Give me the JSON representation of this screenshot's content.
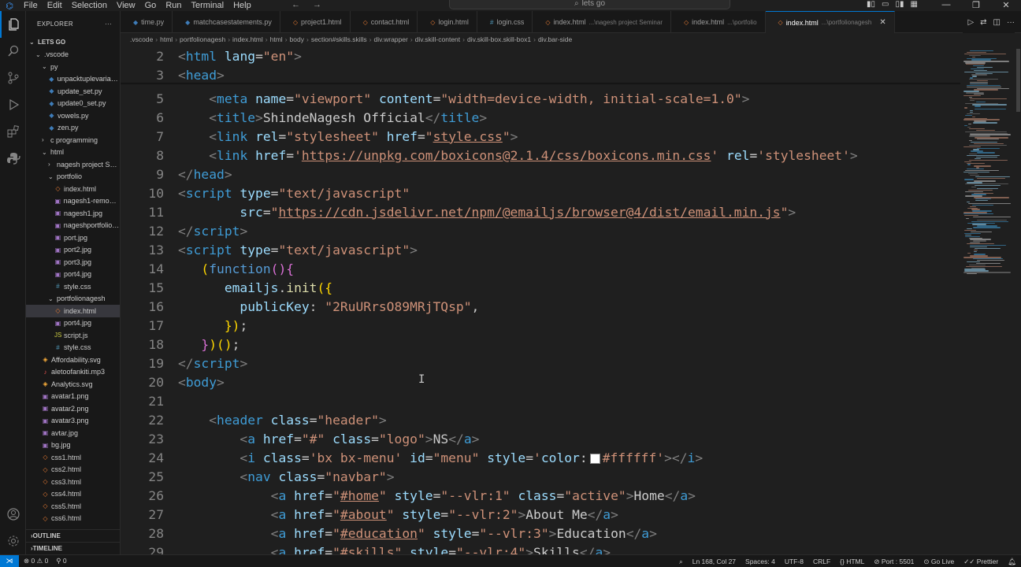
{
  "titlebar": {
    "menu": [
      "File",
      "Edit",
      "Selection",
      "View",
      "Go",
      "Run",
      "Terminal",
      "Help"
    ],
    "search_text": "lets go"
  },
  "explorer": {
    "title": "EXPLORER",
    "more": "···",
    "root": "LETS GO",
    "outline": "OUTLINE",
    "timeline": "TIMELINE"
  },
  "tree": [
    {
      "depth": 1,
      "kind": "folder-open",
      "name": ".vscode"
    },
    {
      "depth": 2,
      "kind": "folder-open",
      "name": "py"
    },
    {
      "depth": 3,
      "kind": "py",
      "name": "unpacktuplevariabl..."
    },
    {
      "depth": 3,
      "kind": "py",
      "name": "update_set.py"
    },
    {
      "depth": 3,
      "kind": "py",
      "name": "update0_set.py"
    },
    {
      "depth": 3,
      "kind": "py",
      "name": "vowels.py"
    },
    {
      "depth": 3,
      "kind": "py",
      "name": "zen.py"
    },
    {
      "depth": 2,
      "kind": "folder",
      "name": "c programming"
    },
    {
      "depth": 2,
      "kind": "folder-open",
      "name": "html"
    },
    {
      "depth": 3,
      "kind": "folder",
      "name": "nagesh project Se..."
    },
    {
      "depth": 3,
      "kind": "folder-open",
      "name": "portfolio"
    },
    {
      "depth": 4,
      "kind": "html",
      "name": "index.html"
    },
    {
      "depth": 4,
      "kind": "img",
      "name": "nagesh1-remove..."
    },
    {
      "depth": 4,
      "kind": "img",
      "name": "nagesh1.jpg"
    },
    {
      "depth": 4,
      "kind": "img",
      "name": "nageshportfolio.j..."
    },
    {
      "depth": 4,
      "kind": "img",
      "name": "port.jpg"
    },
    {
      "depth": 4,
      "kind": "img",
      "name": "port2.jpg"
    },
    {
      "depth": 4,
      "kind": "img",
      "name": "port3.jpg"
    },
    {
      "depth": 4,
      "kind": "img",
      "name": "port4.jpg"
    },
    {
      "depth": 4,
      "kind": "css",
      "name": "style.css"
    },
    {
      "depth": 3,
      "kind": "folder-open",
      "name": "portfolionagesh"
    },
    {
      "depth": 4,
      "kind": "html",
      "name": "index.html",
      "selected": true
    },
    {
      "depth": 4,
      "kind": "img",
      "name": "port4.jpg"
    },
    {
      "depth": 4,
      "kind": "js",
      "name": "script.js"
    },
    {
      "depth": 4,
      "kind": "css",
      "name": "style.css"
    },
    {
      "depth": 2,
      "kind": "svg",
      "name": "Affordability.svg"
    },
    {
      "depth": 2,
      "kind": "mp3",
      "name": "aletoofankiti.mp3"
    },
    {
      "depth": 2,
      "kind": "svg",
      "name": "Analytics.svg"
    },
    {
      "depth": 2,
      "kind": "img",
      "name": "avatar1.png"
    },
    {
      "depth": 2,
      "kind": "img",
      "name": "avatar2.png"
    },
    {
      "depth": 2,
      "kind": "img",
      "name": "avatar3.png"
    },
    {
      "depth": 2,
      "kind": "img",
      "name": "avtar.jpg"
    },
    {
      "depth": 2,
      "kind": "img",
      "name": "bg.jpg"
    },
    {
      "depth": 2,
      "kind": "html",
      "name": "css1.html"
    },
    {
      "depth": 2,
      "kind": "html",
      "name": "css2.html"
    },
    {
      "depth": 2,
      "kind": "html",
      "name": "css3.html"
    },
    {
      "depth": 2,
      "kind": "html",
      "name": "css4.html"
    },
    {
      "depth": 2,
      "kind": "html",
      "name": "css5.html"
    },
    {
      "depth": 2,
      "kind": "html",
      "name": "css6.html"
    }
  ],
  "tabs": [
    {
      "label": "time.py",
      "kind": "py"
    },
    {
      "label": "matchcasestatements.py",
      "kind": "py"
    },
    {
      "label": "project1.html",
      "kind": "html"
    },
    {
      "label": "contact.html",
      "kind": "html"
    },
    {
      "label": "login.html",
      "kind": "html"
    },
    {
      "label": "login.css",
      "kind": "css"
    },
    {
      "label": "index.html",
      "desc": "...\\nagesh project Seminar",
      "kind": "html"
    },
    {
      "label": "index.html",
      "desc": "...\\portfolio",
      "kind": "html"
    },
    {
      "label": "index.html",
      "desc": "...\\portfolionagesh",
      "kind": "html",
      "active": true
    }
  ],
  "breadcrumb": [
    ".vscode",
    "html",
    "portfolionagesh",
    "index.html",
    "html",
    "body",
    "section#skills.skills",
    "div.wrapper",
    "div.skill-content",
    "div.skill-box.skill-box1",
    "div.bar-side"
  ],
  "editor": {
    "line_numbers": [
      "2",
      "3",
      "5",
      "6",
      "7",
      "8",
      "9",
      "10",
      "11",
      "12",
      "13",
      "14",
      "15",
      "16",
      "17",
      "18",
      "19",
      "20",
      "21",
      "22",
      "23",
      "24",
      "25",
      "26",
      "27",
      "28",
      "29"
    ]
  },
  "status": {
    "errors": "0",
    "warnings": "0",
    "ports": "0",
    "position": "Ln 168, Col 27",
    "spaces": "Spaces: 4",
    "encoding": "UTF-8",
    "eol": "CRLF",
    "language": "HTML",
    "port": "Port : 5501",
    "golive": "Go Live",
    "prettier": "Prettier"
  },
  "colors": {
    "accent": "#0078d4",
    "editor_bg": "#1f1f1f",
    "tag": "#3f9cd6",
    "attr": "#9cdcfe",
    "string": "#ce9178"
  }
}
